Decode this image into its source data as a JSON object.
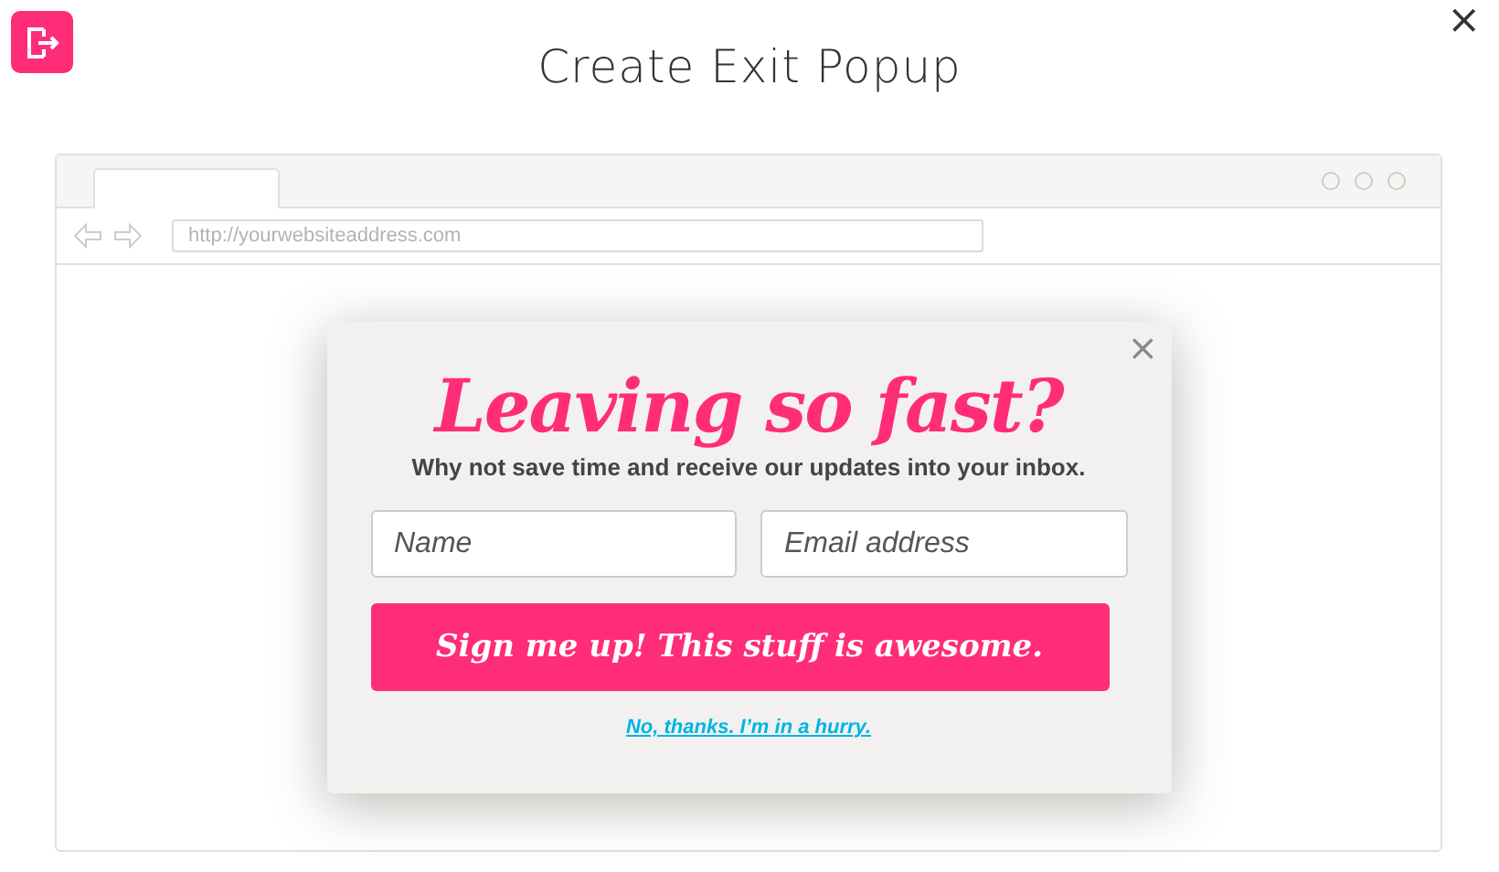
{
  "dialog": {
    "title": "Create Exit Popup",
    "close": "×"
  },
  "browser": {
    "address": "http://yourwebsiteaddress.com"
  },
  "popup": {
    "close": "×",
    "headline": "Leaving so fast?",
    "subtitle": "Why not save time and receive our updates into your inbox.",
    "fields": [
      {
        "placeholder": "Name"
      },
      {
        "placeholder": "Email address"
      }
    ],
    "button": "Sign me up! This stuff is awesome.",
    "decline_link": "No, thanks. I’m in a hurry."
  }
}
